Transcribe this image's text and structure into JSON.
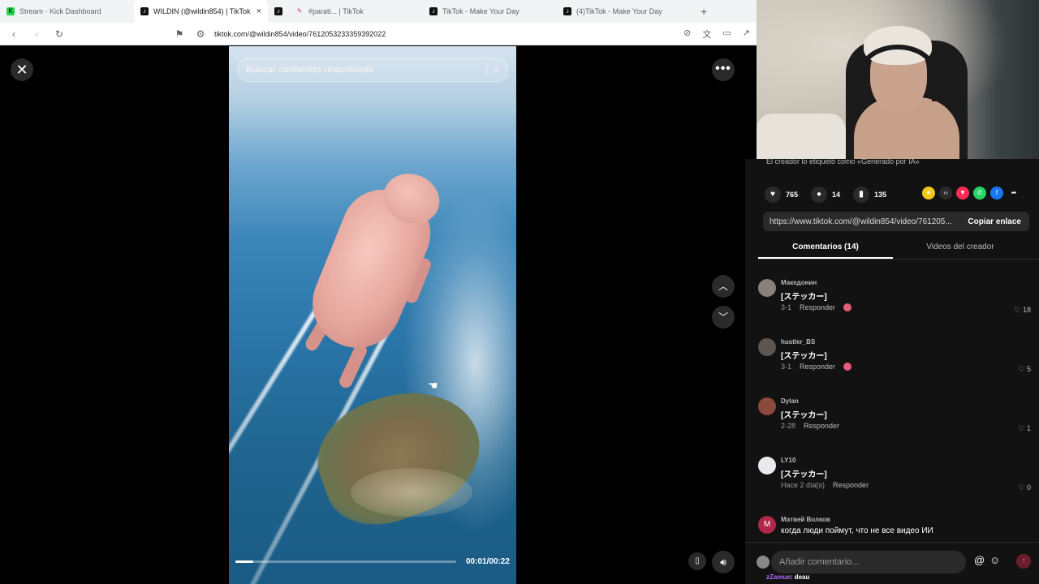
{
  "browser": {
    "tabs": [
      {
        "title": "Stream - Kick Dashboard",
        "icon": "kick-icon",
        "active": false
      },
      {
        "title": "WILDIN (@wildin854) | TikTok",
        "icon": "tiktok-icon",
        "active": true
      },
      {
        "title": "",
        "icon": "tiktok-icon",
        "active": false
      },
      {
        "title": "#parati... | TikTok",
        "icon": "tiktok-pink-icon",
        "active": false
      },
      {
        "title": "TikTok - Make Your Day",
        "icon": "tiktok-icon",
        "active": false
      },
      {
        "title": "(4)TikTok - Make Your Day",
        "icon": "tiktok-icon",
        "active": false
      }
    ],
    "new_tab": "+",
    "url": "tiktok.com/@wildin854/video/7612053233359392022"
  },
  "video": {
    "search_placeholder": "Buscar contenido relacionado",
    "time": "00:01/00:22",
    "progress": 0.08
  },
  "panel": {
    "ai_label": "El creador lo etiquetó como «Generado por IA»",
    "likes": "765",
    "comments_count": "14",
    "saves": "135",
    "link": "https://www.tiktok.com/@wildin854/video/761205...",
    "copy_label": "Copiar enlace",
    "tab_comments": "Comentarios (14)",
    "tab_creator": "Videos del creador"
  },
  "comments": [
    {
      "user": "Македонин",
      "text": "[ステッカー]",
      "date": "3-1",
      "reply": "Responder",
      "likes": "18",
      "creator_liked": true
    },
    {
      "user": "hustler_BS",
      "text": "[ステッカー]",
      "date": "3-1",
      "reply": "Responder",
      "likes": "5",
      "creator_liked": true
    },
    {
      "user": "Dylan",
      "text": "[ステッカー]",
      "date": "2-28",
      "reply": "Responder",
      "likes": "1",
      "creator_liked": false
    },
    {
      "user": "LY10",
      "text": "[ステッカー]",
      "date": "Hace 2 día(s)",
      "reply": "Responder",
      "likes": "0",
      "creator_liked": false
    },
    {
      "user": "Матвей Волков",
      "text": "когда люди поймут, что не все видео ИИ",
      "date": "",
      "reply": "",
      "likes": "",
      "creator_liked": false
    }
  ],
  "comment_bar": {
    "placeholder": "Añadir comentario...",
    "chat_user": "zZamue",
    "chat_text": ": deau"
  },
  "colors": {
    "accent": "#fe2c55",
    "panel_bg": "#121212",
    "chat_user": "#b26cff"
  }
}
